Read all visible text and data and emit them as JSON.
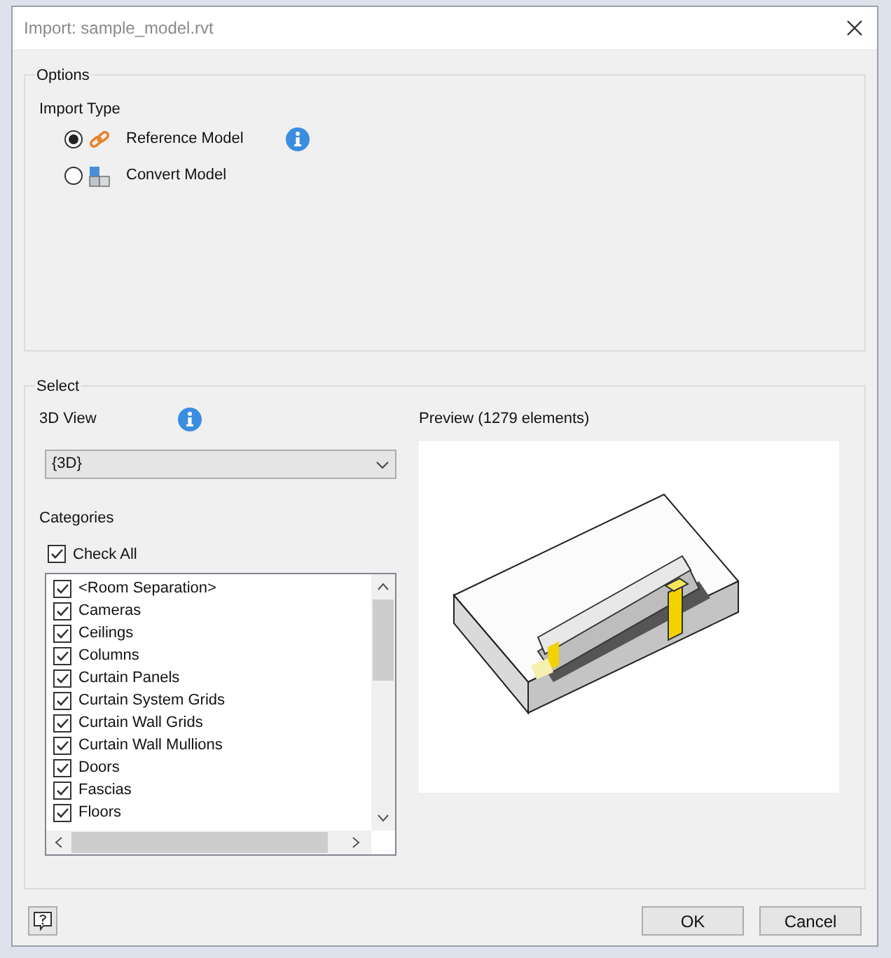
{
  "window": {
    "title": "Import:  sample_model.rvt"
  },
  "options": {
    "title": "Options",
    "import_type_label": "Import Type",
    "import_types": [
      {
        "label": "Reference Model",
        "kind": "link",
        "selected": true,
        "info": true
      },
      {
        "label": "Convert Model",
        "kind": "convert",
        "selected": false,
        "info": false
      }
    ]
  },
  "select": {
    "title": "Select",
    "view_label": "3D View",
    "view_value": "{3D}",
    "preview_label": "Preview (1279 elements)",
    "categories_label": "Categories",
    "check_all": {
      "label": "Check All",
      "checked": true
    },
    "categories": [
      {
        "label": "<Room Separation>",
        "checked": true
      },
      {
        "label": "Cameras",
        "checked": true
      },
      {
        "label": "Ceilings",
        "checked": true
      },
      {
        "label": "Columns",
        "checked": true
      },
      {
        "label": "Curtain Panels",
        "checked": true
      },
      {
        "label": "Curtain System Grids",
        "checked": true
      },
      {
        "label": "Curtain Wall Grids",
        "checked": true
      },
      {
        "label": "Curtain Wall Mullions",
        "checked": true
      },
      {
        "label": "Doors",
        "checked": true
      },
      {
        "label": "Fascias",
        "checked": true
      },
      {
        "label": "Floors",
        "checked": true
      }
    ]
  },
  "buttons": [
    "OK",
    "Cancel"
  ]
}
